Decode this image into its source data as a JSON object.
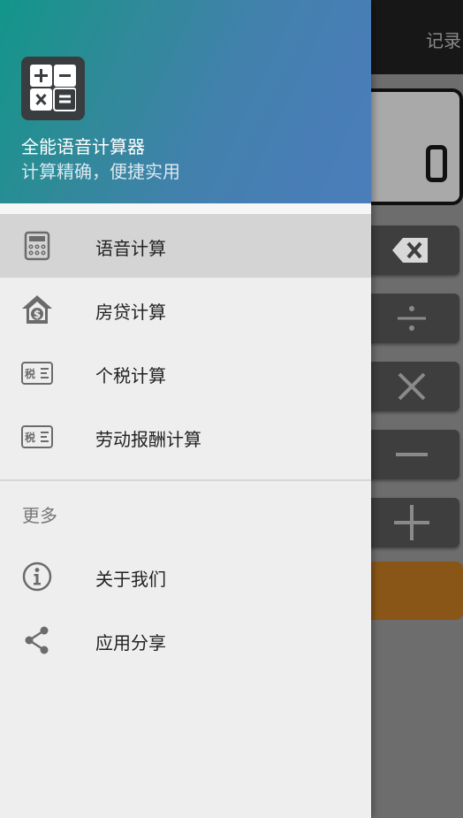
{
  "background_app": {
    "record_label": "记录",
    "display_value": "0"
  },
  "drawer": {
    "app_name": "全能语音计算器",
    "app_slogan": "计算精确，便捷实用",
    "logo_icon": "calculator-grid-icon",
    "items": [
      {
        "label": "语音计算",
        "icon": "calculator-icon",
        "active": true
      },
      {
        "label": "房贷计算",
        "icon": "house-money-icon",
        "active": false
      },
      {
        "label": "个税计算",
        "icon": "tax-card-icon",
        "icon_text": "税",
        "active": false
      },
      {
        "label": "劳动报酬计算",
        "icon": "tax-card-icon",
        "icon_text": "税",
        "active": false
      }
    ],
    "more_section": {
      "title": "更多",
      "items": [
        {
          "label": "关于我们",
          "icon": "info-icon"
        },
        {
          "label": "应用分享",
          "icon": "share-icon"
        }
      ]
    }
  },
  "colors": {
    "header_start": "#12968a",
    "header_end": "#4b7dbb",
    "drawer_bg": "#eeeeee",
    "active_item": "#d4d4d4",
    "equals_key": "#8a5618"
  }
}
